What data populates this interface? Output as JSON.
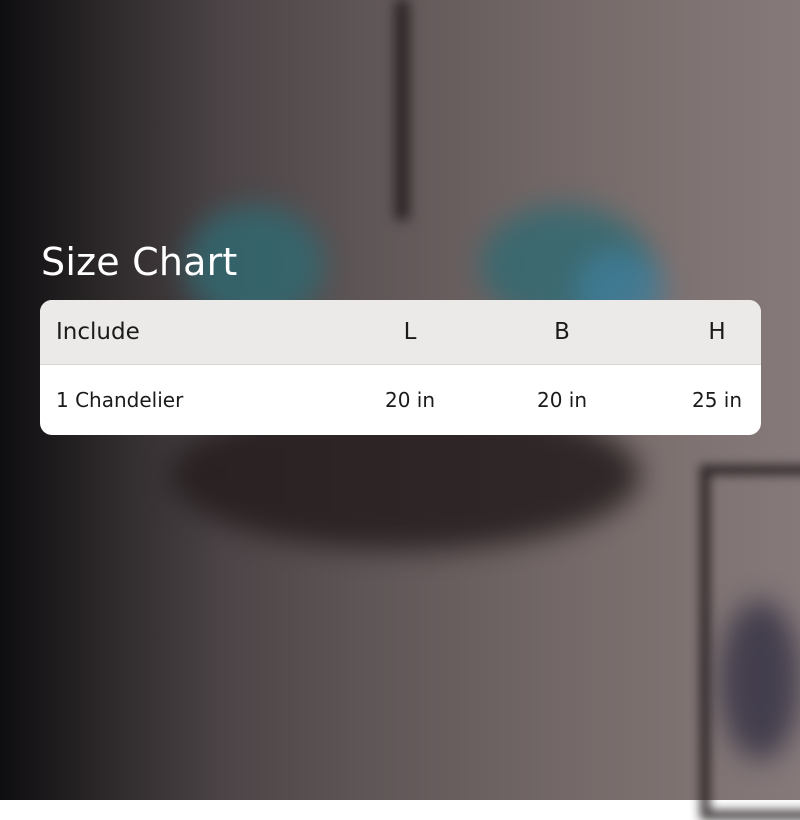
{
  "title": "Size Chart",
  "table": {
    "headers": [
      "Include",
      "L",
      "B",
      "H"
    ],
    "rows": [
      [
        "1 Chandelier",
        "20 in",
        "20 in",
        "25 in"
      ]
    ]
  },
  "colors": {
    "card_background": "#ffffff",
    "header_background": "#ebeae8",
    "text": "#1b1b1b",
    "title": "#ffffff"
  }
}
